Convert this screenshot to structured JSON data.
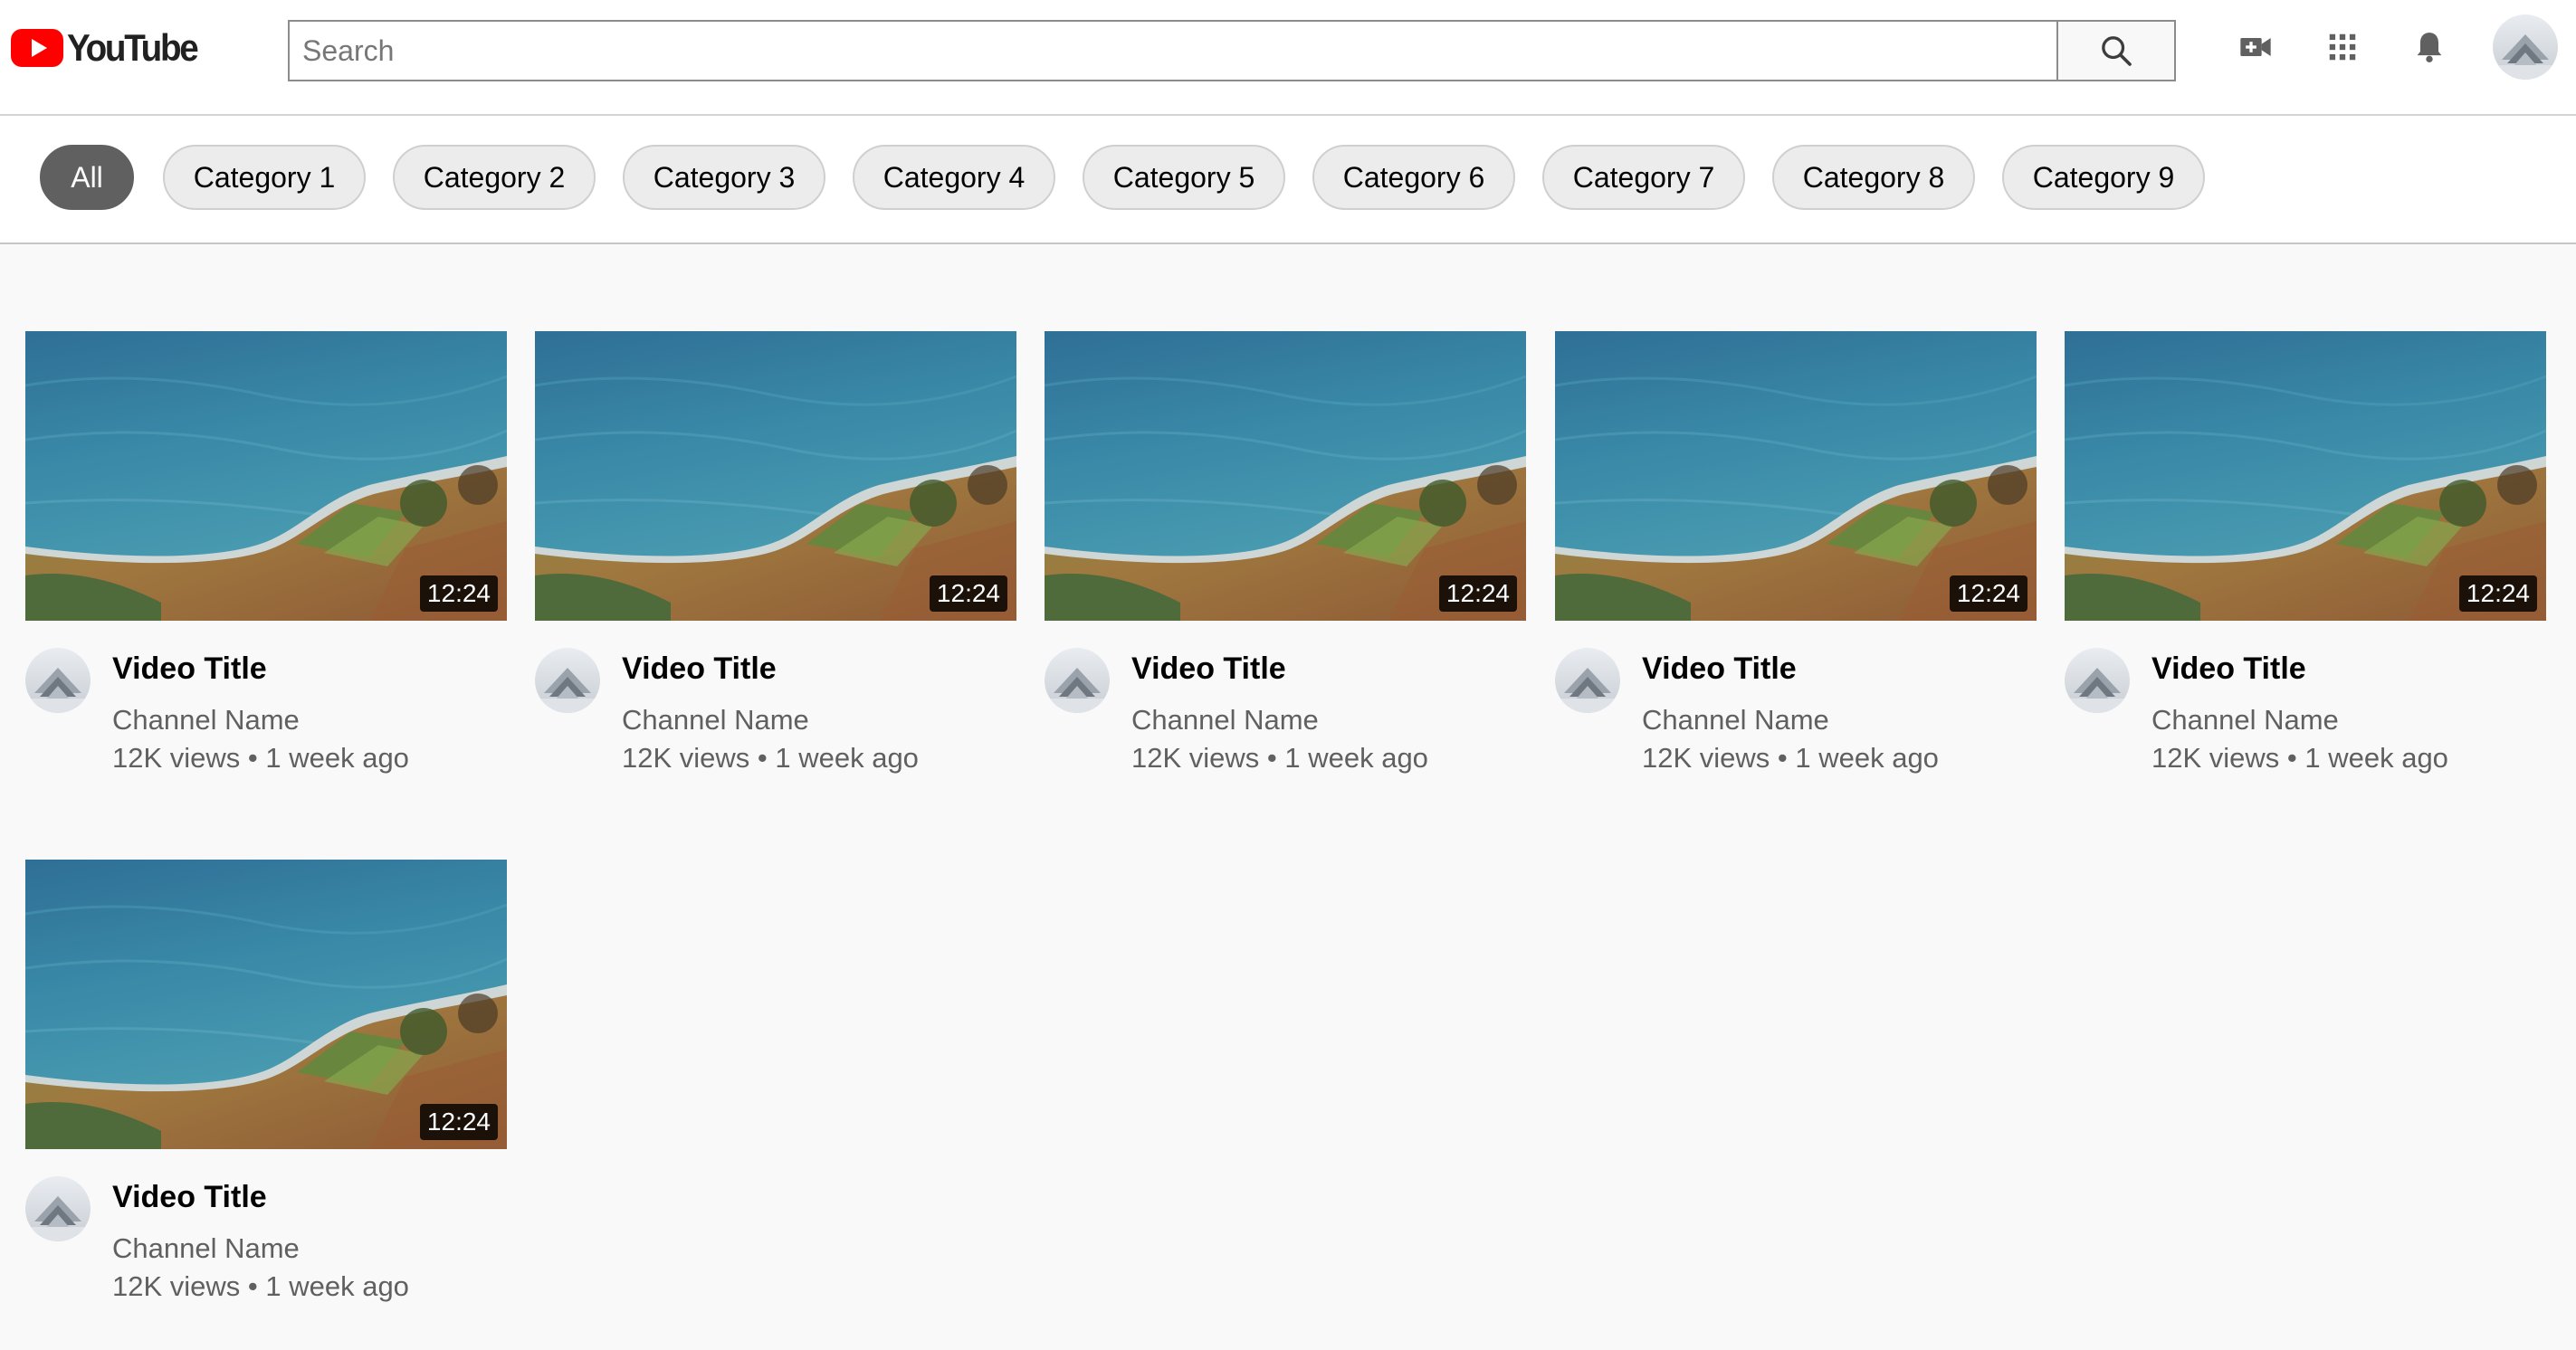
{
  "header": {
    "logo_text": "YouTube",
    "search_placeholder": "Search"
  },
  "icons": {
    "create": "video-camera-plus-icon",
    "apps": "apps-grid-icon",
    "notifications": "bell-icon",
    "search": "magnifier-icon"
  },
  "colors": {
    "brand_red": "#ff0000",
    "active_chip": "#606060",
    "chip_bg": "#ececec",
    "page_bg": "#f9f9f9"
  },
  "chips": [
    {
      "label": "All",
      "active": true
    },
    {
      "label": "Category 1"
    },
    {
      "label": "Category 2"
    },
    {
      "label": "Category 3"
    },
    {
      "label": "Category 4"
    },
    {
      "label": "Category 5"
    },
    {
      "label": "Category 6"
    },
    {
      "label": "Category 7"
    },
    {
      "label": "Category 8"
    },
    {
      "label": "Category 9"
    }
  ],
  "videos": [
    {
      "title": "Video Title",
      "channel": "Channel Name",
      "meta": "12K views • 1 week ago",
      "duration": "12:24"
    },
    {
      "title": "Video Title",
      "channel": "Channel Name",
      "meta": "12K views • 1 week ago",
      "duration": "12:24"
    },
    {
      "title": "Video Title",
      "channel": "Channel Name",
      "meta": "12K views • 1 week ago",
      "duration": "12:24"
    },
    {
      "title": "Video Title",
      "channel": "Channel Name",
      "meta": "12K views • 1 week ago",
      "duration": "12:24"
    },
    {
      "title": "Video Title",
      "channel": "Channel Name",
      "meta": "12K views • 1 week ago",
      "duration": "12:24"
    },
    {
      "title": "Video Title",
      "channel": "Channel Name",
      "meta": "12K views • 1 week ago",
      "duration": "12:24"
    }
  ]
}
